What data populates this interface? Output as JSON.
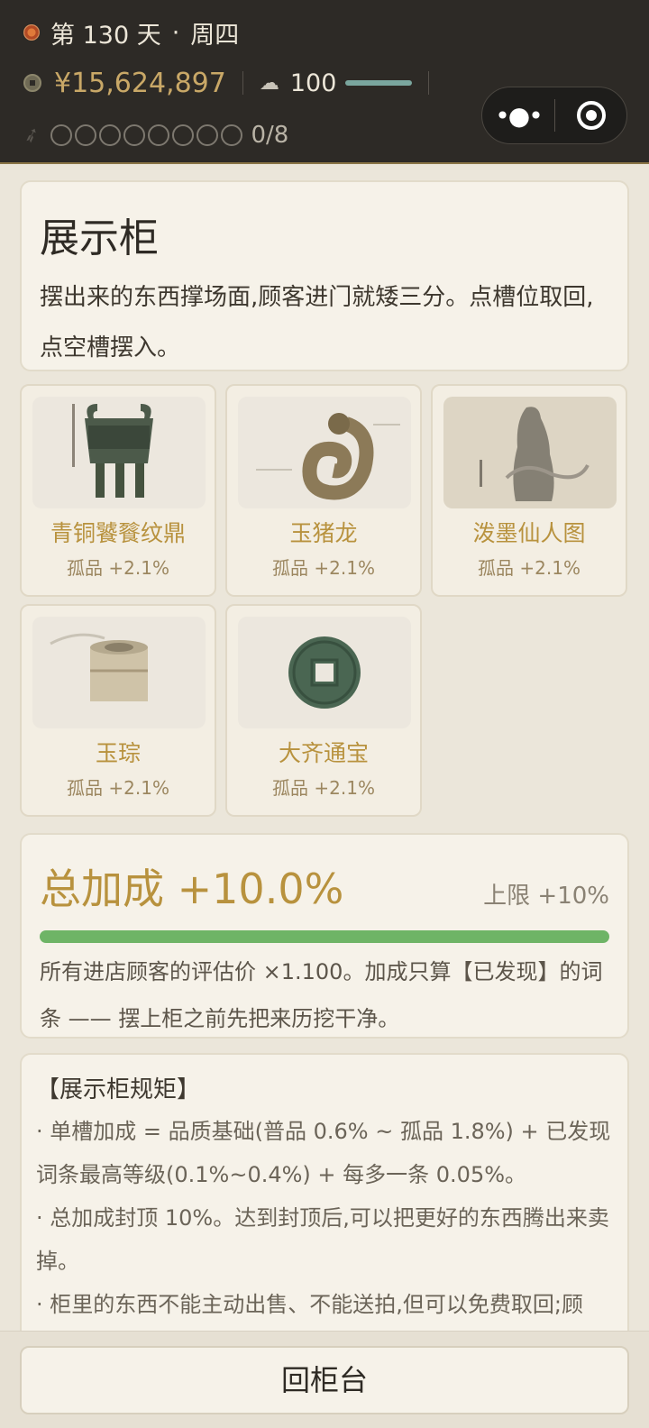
{
  "status": {
    "day_label": "第 130 天",
    "sep": "·",
    "weekday": "周四",
    "money": "¥15,624,897",
    "reputation": "100",
    "slots_text": "0/8",
    "slot_circles": 8
  },
  "intro": {
    "title": "展示柜",
    "desc": "摆出来的东西撑场面,顾客进门就矮三分。点槽位取回,点空槽摆入。"
  },
  "items": [
    {
      "name": "青铜饕餮纹鼎",
      "tag": "孤品 +2.1%",
      "icon": "bronze-ding-icon"
    },
    {
      "name": "玉猪龙",
      "tag": "孤品 +2.1%",
      "icon": "jade-pig-dragon-icon"
    },
    {
      "name": "泼墨仙人图",
      "tag": "孤品 +2.1%",
      "icon": "ink-immortal-painting-icon"
    },
    {
      "name": "玉琮",
      "tag": "孤品 +2.1%",
      "icon": "jade-cong-icon"
    },
    {
      "name": "大齐通宝",
      "tag": "孤品 +2.1%",
      "icon": "coin-daqi-tongbao-icon"
    }
  ],
  "total": {
    "title": "总加成 +10.0%",
    "limit": "上限 +10%",
    "progress": 1.0,
    "desc": "所有进店顾客的评估价 ×1.100。加成只算【已发现】的词条 —— 摆上柜之前先把来历挖干净。"
  },
  "rules": {
    "title": "【展示柜规矩】",
    "lines": [
      "· 单槽加成 = 品质基础(普品 0.6% ~ 孤品 1.8%) + 已发现词条最高等级(0.1%~0.4%) + 每多一条 0.05%。",
      "· 总加成封顶 10%。达到封顶后,可以把更好的东西腾出来卖掉。",
      "· 柜里的东西不能主动出售、不能送拍,但可以免费取回;顾"
    ]
  },
  "footer": {
    "button": "回柜台"
  },
  "colors": {
    "accent": "#b8923e",
    "progress": "#6eb466",
    "topbar": "#2d2a26"
  }
}
